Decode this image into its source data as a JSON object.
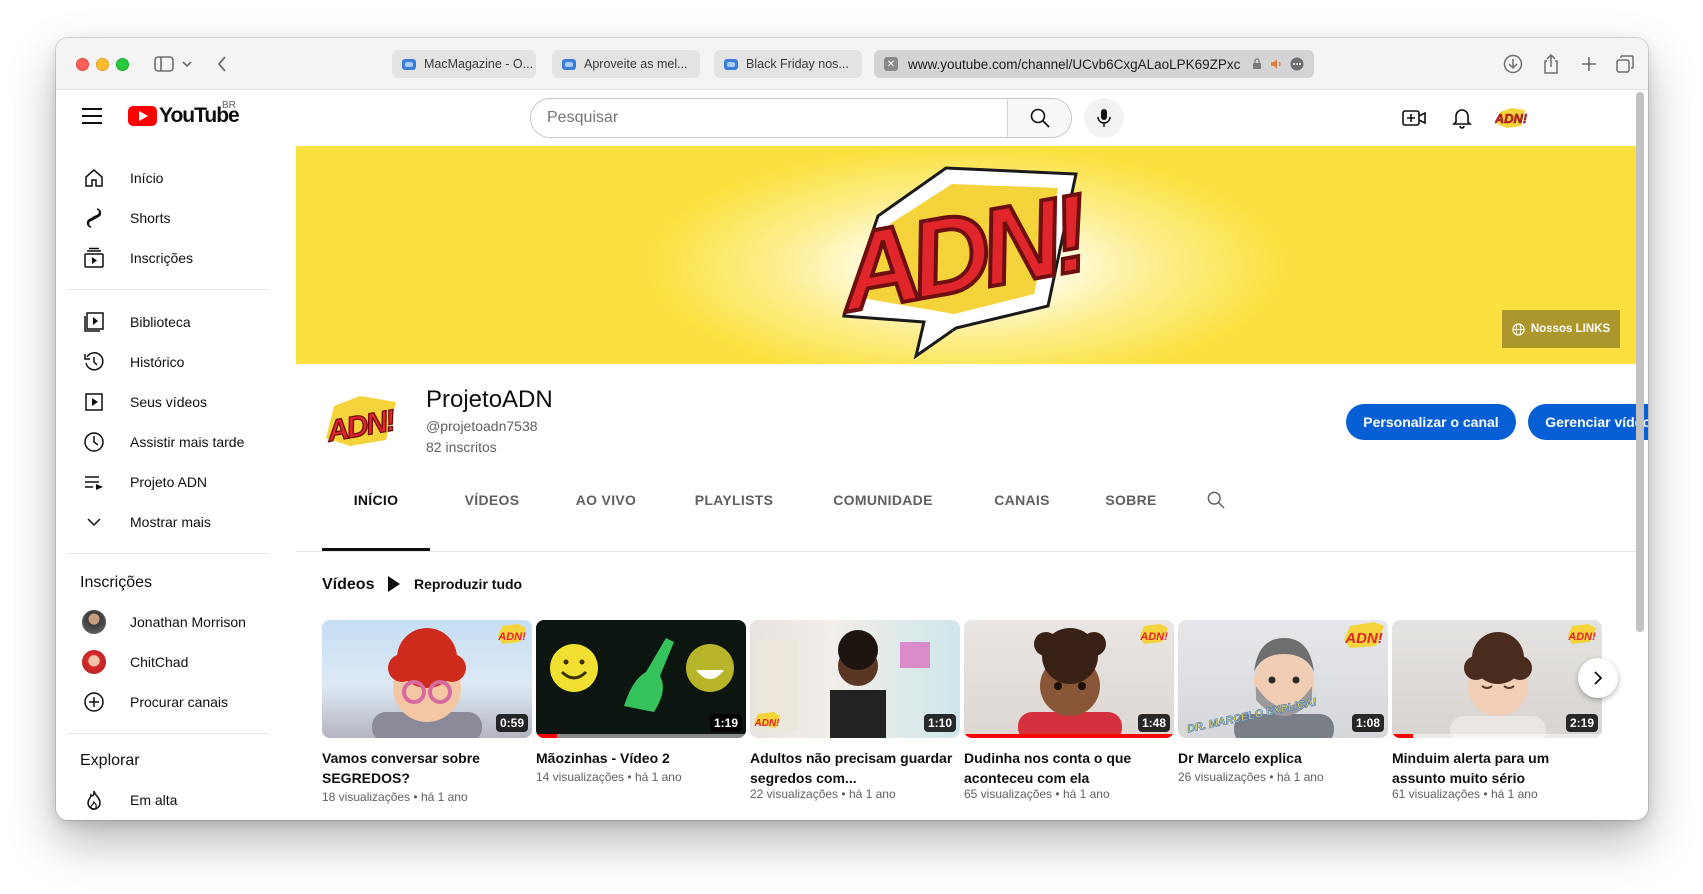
{
  "browser": {
    "tabs": [
      {
        "label": "MacMagazine - O..."
      },
      {
        "label": "Aproveite as mel..."
      },
      {
        "label": "Black Friday nos..."
      }
    ],
    "active_tab_url": "www.youtube.com/channel/UCvb6CxgALaoLPK69ZPxc"
  },
  "masthead": {
    "logo_text": "YouTube",
    "country": "BR",
    "search_placeholder": "Pesquisar"
  },
  "sidebar": {
    "main": [
      {
        "label": "Início",
        "icon": "home-icon"
      },
      {
        "label": "Shorts",
        "icon": "shorts-icon"
      },
      {
        "label": "Inscrições",
        "icon": "subscriptions-icon"
      }
    ],
    "library": [
      {
        "label": "Biblioteca",
        "icon": "library-icon"
      },
      {
        "label": "Histórico",
        "icon": "history-icon"
      },
      {
        "label": "Seus vídeos",
        "icon": "your-videos-icon"
      },
      {
        "label": "Assistir mais tarde",
        "icon": "watch-later-icon"
      },
      {
        "label": "Projeto ADN",
        "icon": "playlist-icon"
      },
      {
        "label": "Mostrar mais",
        "icon": "chevron-down-icon"
      }
    ],
    "subscriptions_title": "Inscrições",
    "subscriptions": [
      {
        "label": "Jonathan Morrison"
      },
      {
        "label": "ChitChad"
      },
      {
        "label": "Procurar canais"
      }
    ],
    "explore_title": "Explorar",
    "explore": [
      {
        "label": "Em alta"
      }
    ]
  },
  "channel": {
    "banner_logo": "ADN!",
    "links_button": "Nossos LINKS",
    "avatar_logo": "ADN!",
    "name": "ProjetoADN",
    "handle": "@projetoadn7538",
    "subscribers": "82 inscritos",
    "customize_button": "Personalizar o canal",
    "manage_button": "Gerenciar vídeos",
    "tabs": [
      "INÍCIO",
      "VÍDEOS",
      "AO VIVO",
      "PLAYLISTS",
      "COMUNIDADE",
      "CANAIS",
      "SOBRE"
    ]
  },
  "videos_section": {
    "title": "Vídeos",
    "play_all": "Reproduzir tudo",
    "items": [
      {
        "title": "Vamos conversar sobre SEGREDOS?",
        "views": "18 visualizações",
        "age": "há 1 ano",
        "duration": "0:59",
        "progress": 0
      },
      {
        "title": "Mãozinhas - Vídeo 2",
        "views": "14 visualizações",
        "age": "há 1 ano",
        "duration": "1:19",
        "progress": 0.1
      },
      {
        "title": "Adultos não precisam guardar segredos com...",
        "views": "22 visualizações",
        "age": "há 1 ano",
        "duration": "1:10",
        "progress": 0
      },
      {
        "title": "Dudinha nos conta o que aconteceu com ela",
        "views": "65 visualizações",
        "age": "há 1 ano",
        "duration": "1:48",
        "progress": 1.0
      },
      {
        "title": "Dr Marcelo explica",
        "views": "26 visualizações",
        "age": "há 1 ano",
        "duration": "1:08",
        "progress": 0
      },
      {
        "title": "Minduim alerta para um assunto muito sério",
        "views": "61 visualizações",
        "age": "há 1 ano",
        "duration": "2:19",
        "progress": 0.1
      }
    ],
    "thumb_text": {
      "dr_marcelo": "DR. MARCELO EXPLICA!"
    }
  },
  "colors": {
    "youtube_red": "#ff0000",
    "primary_blue": "#065fd4",
    "banner_yellow": "#fbe13f"
  }
}
